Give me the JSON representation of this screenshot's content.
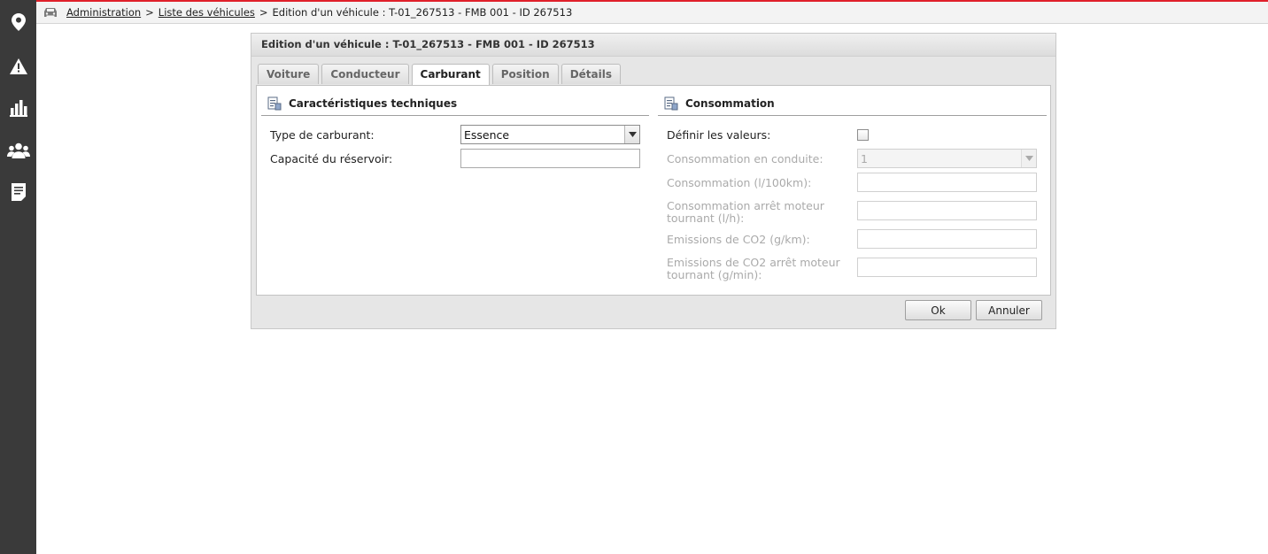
{
  "breadcrumb": {
    "item1": "Administration",
    "sep1": ">",
    "item2": "Liste des véhicules",
    "sep2": ">",
    "current": "Edition d'un véhicule : T-01_267513 - FMB 001 - ID 267513"
  },
  "sidebar": {
    "items": [
      {
        "icon": "location-pin-icon"
      },
      {
        "icon": "warning-icon"
      },
      {
        "icon": "bar-chart-icon"
      },
      {
        "icon": "users-icon"
      },
      {
        "icon": "document-icon"
      }
    ]
  },
  "dialog": {
    "title": "Edition d'un véhicule : T-01_267513 - FMB 001 - ID 267513",
    "tabs": [
      {
        "label": "Voiture"
      },
      {
        "label": "Conducteur"
      },
      {
        "label": "Carburant",
        "active": true
      },
      {
        "label": "Position"
      },
      {
        "label": "Détails"
      }
    ],
    "left_section": {
      "title": "Caractéristiques techniques",
      "fuel_type_label": "Type de carburant:",
      "fuel_type_value": "Essence",
      "tank_capacity_label": "Capacité du réservoir:",
      "tank_capacity_value": ""
    },
    "right_section": {
      "title": "Consommation",
      "define_values_label": "Définir les valeurs:",
      "define_values_checked": false,
      "driving_consumption_label": "Consommation en conduite:",
      "driving_consumption_value": "1",
      "consumption_100km_label": "Consommation (l/100km):",
      "idle_consumption_label": "Consommation arrêt moteur tournant (l/h):",
      "co2_label": "Emissions de CO2 (g/km):",
      "co2_idle_label": "Emissions de CO2 arrêt moteur tournant (g/min):"
    },
    "ok_label": "Ok",
    "cancel_label": "Annuler"
  },
  "colors": {
    "accent_line": "#e0202a",
    "sidebar_bg": "#3a3a3a"
  }
}
